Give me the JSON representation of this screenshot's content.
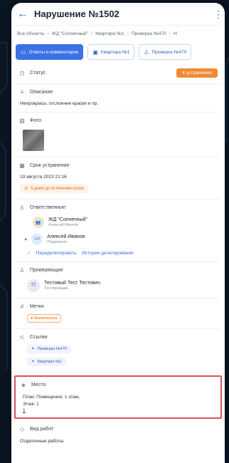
{
  "header": {
    "title": "Нарушение №1502"
  },
  "breadcrumbs": [
    "Все объекты",
    "ЖД \"Солнечный\"",
    "Квартира №1",
    "Проверка №470",
    "Н"
  ],
  "tabs": [
    {
      "label": "Ответы и комментарии",
      "active": true
    },
    {
      "label": "Квартира №1",
      "active": false
    },
    {
      "label": "Проверка №470",
      "active": false
    }
  ],
  "status": {
    "label": "Статус",
    "value": "К устранению",
    "color": "#f08a34"
  },
  "description": {
    "label": "Описание",
    "text": "Непрокрасы, отслоение краски и пр."
  },
  "photo": {
    "label": "Фото"
  },
  "deadline": {
    "label": "Срок устранения",
    "date": "19 августа 2023 21:16",
    "chip": "5 дней до истечения срока"
  },
  "responsible": {
    "label": "Ответственные",
    "people": [
      {
        "name": "ЖД \"Солнечный\"",
        "sub": "Алексей Иванов"
      },
      {
        "name": "Алексей Иванов",
        "sub": "Подрядчик"
      }
    ],
    "actions": [
      "Переделегировать",
      "История делегирования"
    ]
  },
  "inspectors": {
    "label": "Проверяющие",
    "person": {
      "initials": "ТТ",
      "name": "Тестовый Тест Тестович",
      "sub": "Тестировщик"
    }
  },
  "marks": {
    "label": "Метки",
    "tag": "Значительно"
  },
  "links": {
    "label": "Ссылки",
    "items": [
      "Проверка №470",
      "Квартира №1"
    ]
  },
  "place": {
    "label": "Место",
    "line1": "План: Помещения, 1 этаж,",
    "line2": "Этаж: 1",
    "link": "1"
  },
  "work": {
    "label": "Вид работ",
    "text": "Отделочные работы"
  }
}
